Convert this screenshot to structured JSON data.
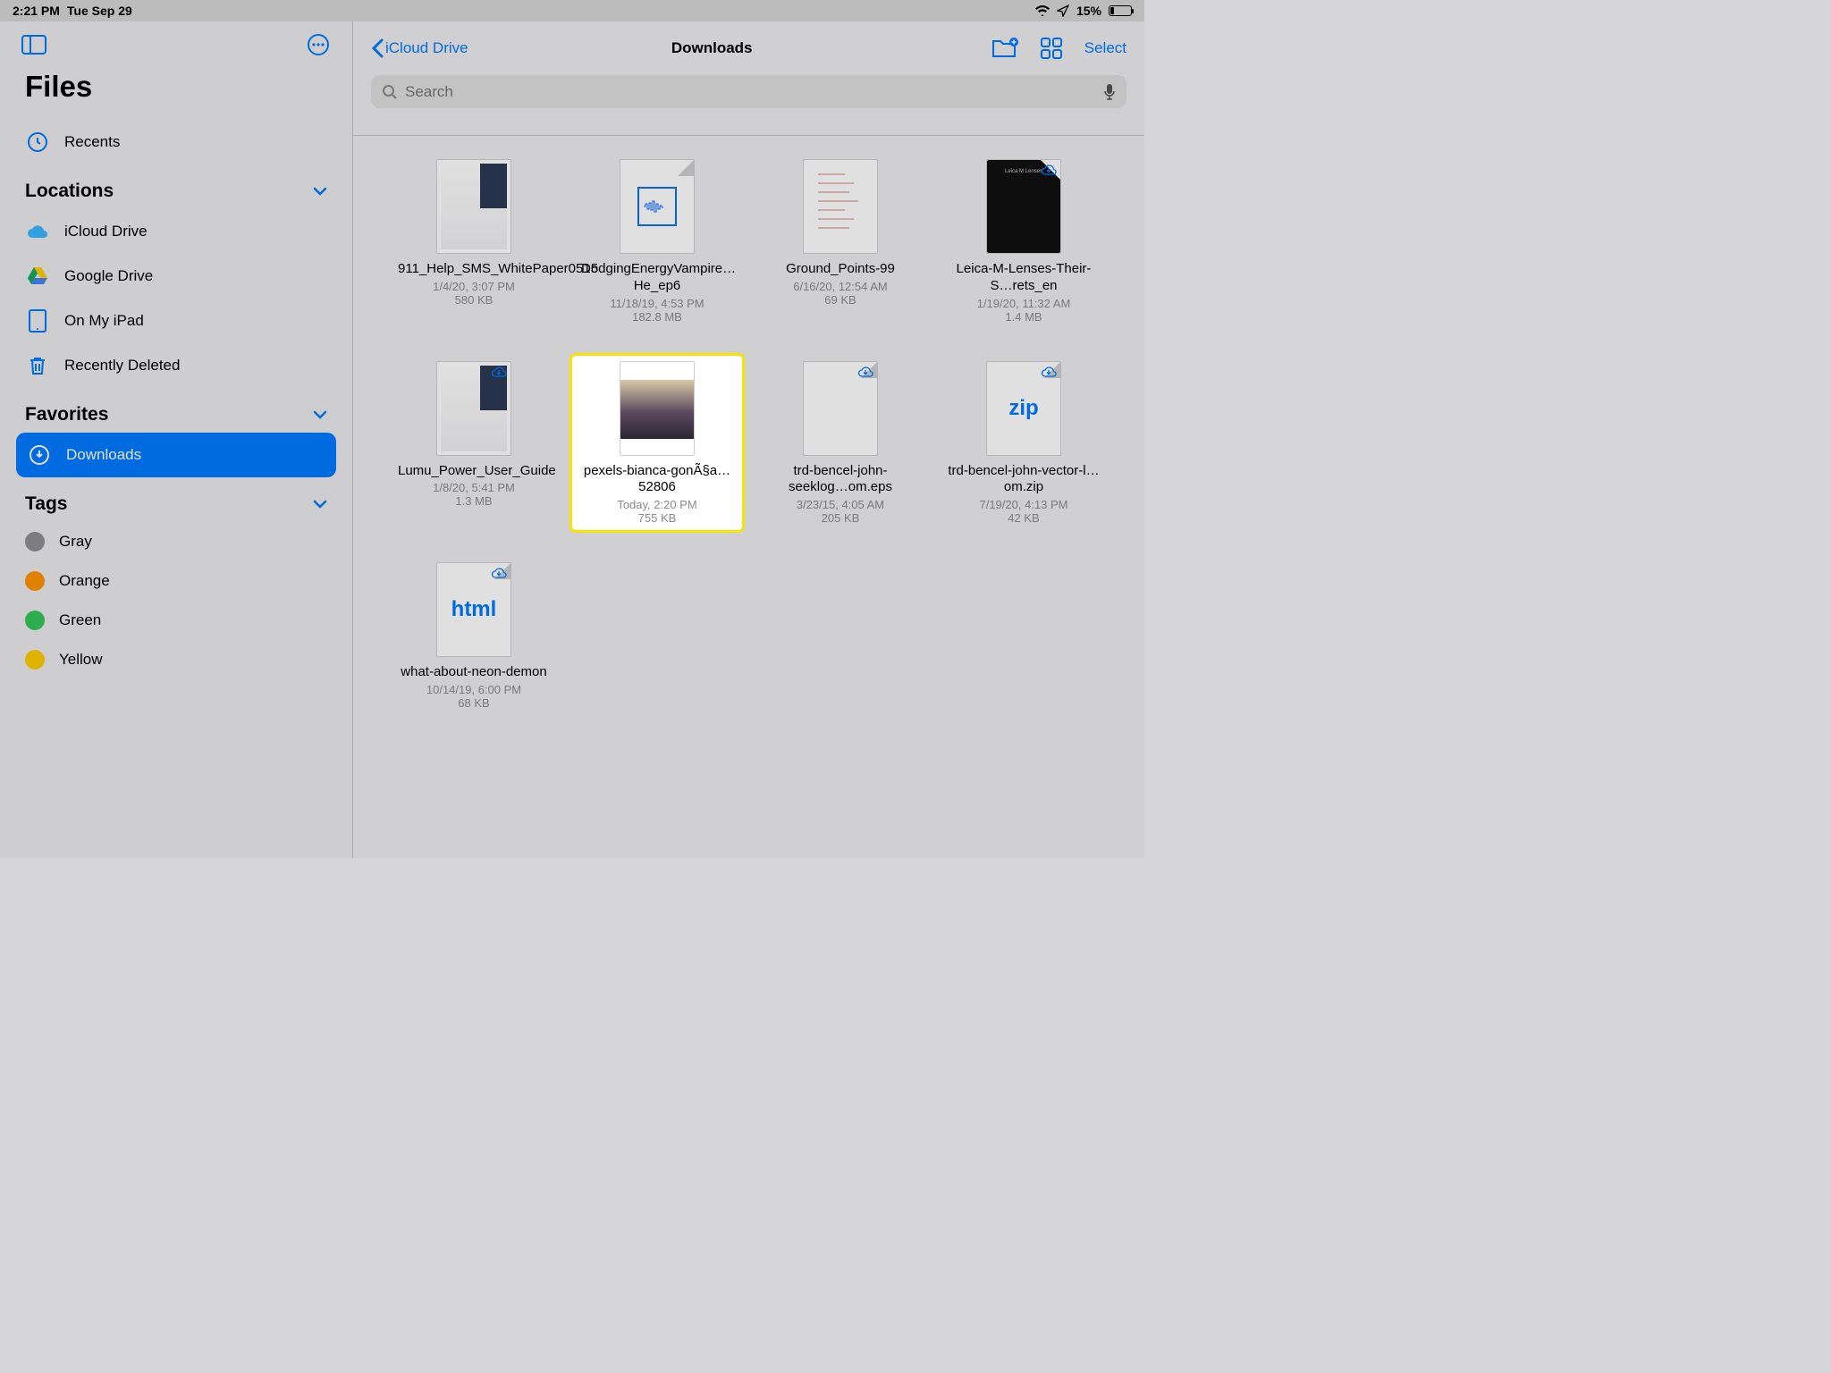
{
  "statusbar": {
    "time": "2:21 PM",
    "date": "Tue Sep 29",
    "battery": "15%"
  },
  "sidebar": {
    "title": "Files",
    "recents": "Recents",
    "sections": {
      "locations": {
        "header": "Locations",
        "items": [
          "iCloud Drive",
          "Google Drive",
          "On My iPad",
          "Recently Deleted"
        ]
      },
      "favorites": {
        "header": "Favorites",
        "items": [
          "Downloads"
        ]
      },
      "tags": {
        "header": "Tags",
        "items": [
          {
            "label": "Gray",
            "color": "#8e8e93"
          },
          {
            "label": "Orange",
            "color": "#ff9500"
          },
          {
            "label": "Green",
            "color": "#34c759"
          },
          {
            "label": "Yellow",
            "color": "#ffcc00"
          }
        ]
      }
    }
  },
  "main": {
    "back": "iCloud Drive",
    "title": "Downloads",
    "select": "Select",
    "search_placeholder": "Search",
    "files": [
      {
        "name": "911_Help_SMS_WhitePaper0515",
        "date": "1/4/20, 3:07 PM",
        "size": "580 KB",
        "kind": "doc",
        "cloud": false,
        "selected": false
      },
      {
        "name": "DodgingEnergyVampire…He_ep6",
        "date": "11/18/19, 4:53 PM",
        "size": "182.8 MB",
        "kind": "audio",
        "cloud": false,
        "selected": false
      },
      {
        "name": "Ground_Points-99",
        "date": "6/16/20, 12:54 AM",
        "size": "69 KB",
        "kind": "diagram",
        "cloud": false,
        "selected": false
      },
      {
        "name": "Leica-M-Lenses-Their-S…rets_en",
        "date": "1/19/20, 11:32 AM",
        "size": "1.4 MB",
        "kind": "pdf-dark",
        "cloud": true,
        "selected": false
      },
      {
        "name": "Lumu_Power_User_Guide",
        "date": "1/8/20, 5:41 PM",
        "size": "1.3 MB",
        "kind": "doc",
        "cloud": true,
        "selected": false
      },
      {
        "name": "pexels-bianca-gonÃ§a…52806",
        "date": "Today, 2:20 PM",
        "size": "755 KB",
        "kind": "image",
        "cloud": false,
        "selected": true
      },
      {
        "name": "trd-bencel-john-seeklog…om.eps",
        "date": "3/23/15, 4:05 AM",
        "size": "205 KB",
        "kind": "blank",
        "cloud": true,
        "selected": false
      },
      {
        "name": "trd-bencel-john-vector-l…om.zip",
        "date": "7/19/20, 4:13 PM",
        "size": "42 KB",
        "kind": "zip",
        "cloud": true,
        "selected": false
      },
      {
        "name": "what-about-neon-demon",
        "date": "10/14/19, 6:00 PM",
        "size": "68 KB",
        "kind": "html",
        "cloud": true,
        "selected": false
      }
    ]
  }
}
